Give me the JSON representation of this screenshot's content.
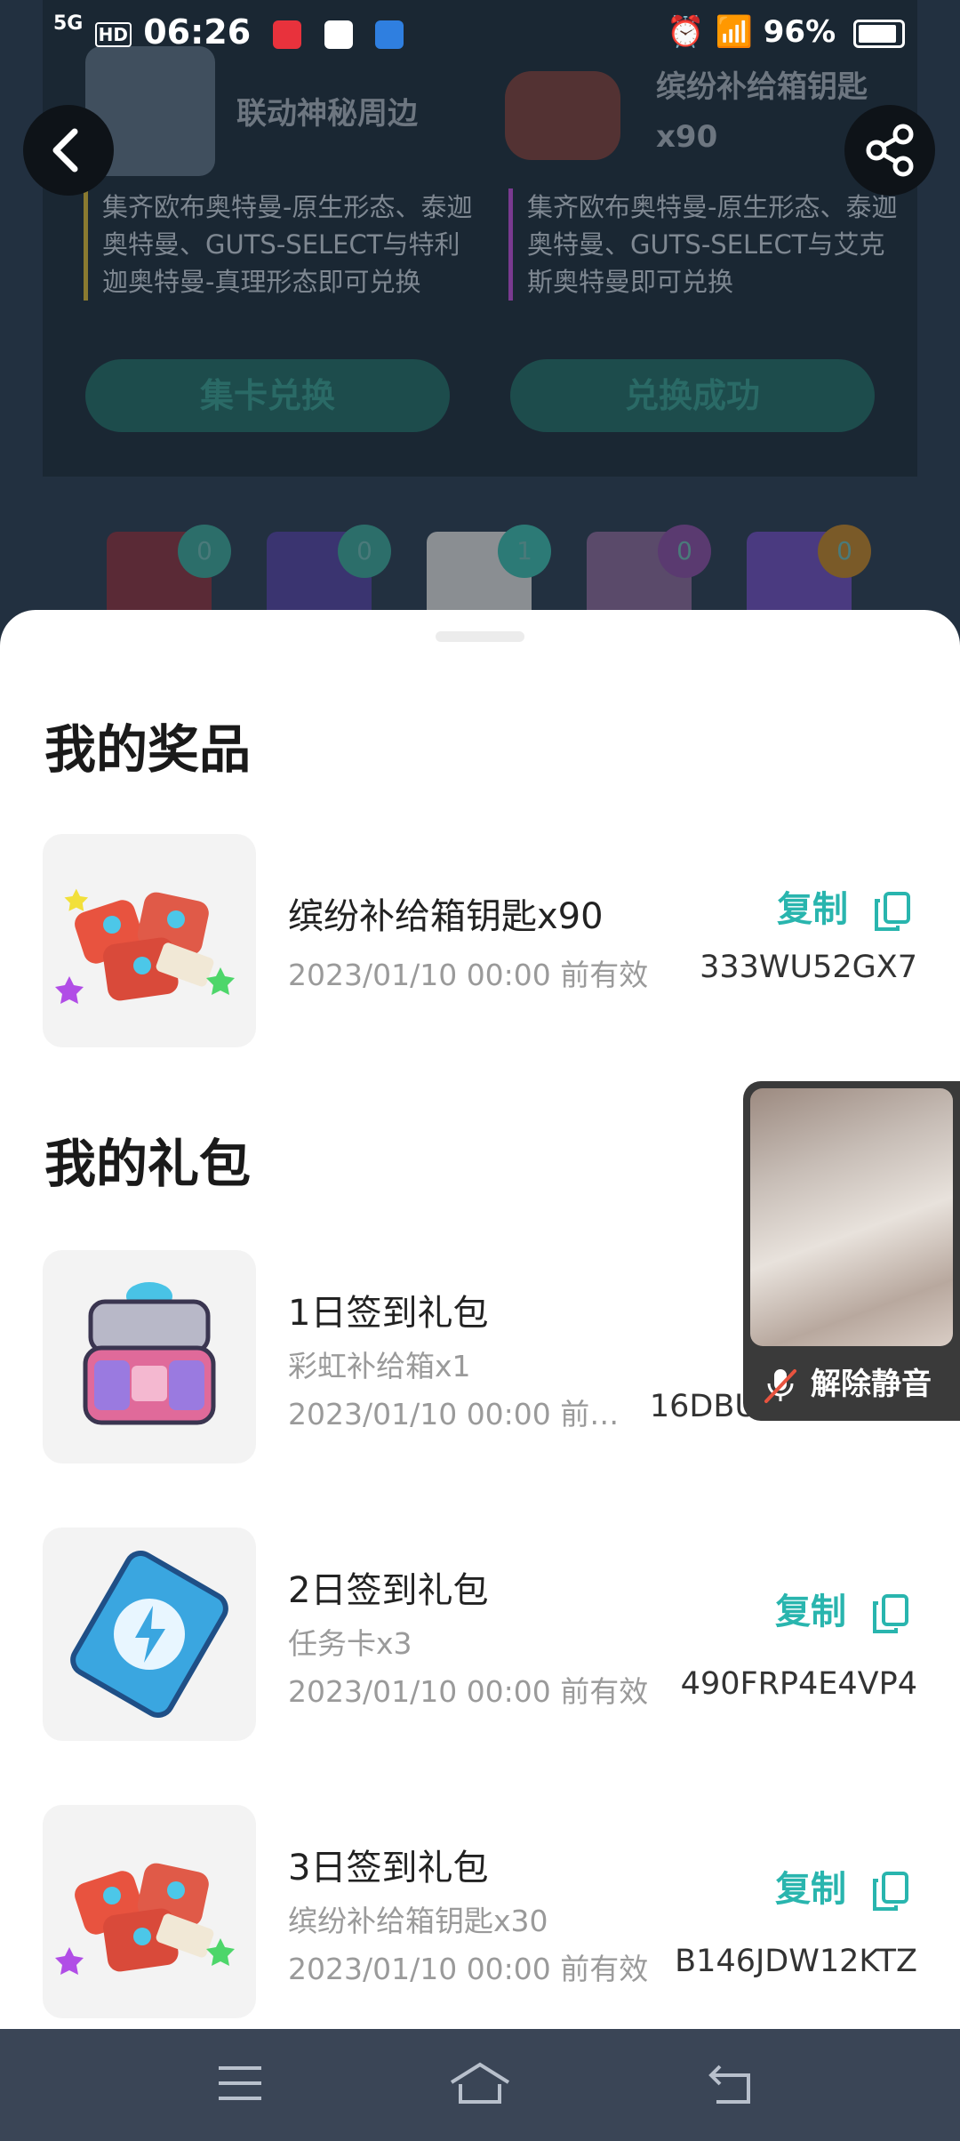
{
  "status_bar": {
    "network": "5G",
    "hd": "HD",
    "time": "06:26",
    "battery": "96%"
  },
  "background": {
    "cards": [
      {
        "title": "联动神秘周边",
        "desc": "集齐欧布奥特曼-原生形态、泰迦奥特曼、GUTS-SELECT与特利迦奥特曼-真理形态即可兑换",
        "button": "集卡兑换"
      },
      {
        "title": "缤纷补给箱钥匙x90",
        "desc": "集齐欧布奥特曼-原生形态、泰迦奥特曼、GUTS-SELECT与艾克斯奥特曼即可兑换",
        "button": "兑换成功"
      }
    ],
    "counts": [
      "0",
      "0",
      "1",
      "0",
      "0"
    ]
  },
  "prizes": {
    "title": "我的奖品",
    "items": [
      {
        "name": "缤纷补给箱钥匙x90",
        "date": "2023/01/10 00:00 前有效",
        "code": "333WU52GX7",
        "copy": "复制",
        "icon": "supply-keys"
      }
    ]
  },
  "gifts": {
    "title": "我的礼包",
    "items": [
      {
        "name": "1日签到礼包",
        "sub": "彩虹补给箱x1",
        "date": "2023/01/10 00:00 前…",
        "code": "16DBU",
        "icon": "rainbow-chest"
      },
      {
        "name": "2日签到礼包",
        "sub": "任务卡x3",
        "date": "2023/01/10 00:00 前有效",
        "code": "490FRP4E4VP4",
        "copy": "复制",
        "icon": "task-card"
      },
      {
        "name": "3日签到礼包",
        "sub": "缤纷补给箱钥匙x30",
        "date": "2023/01/10 00:00 前有效",
        "code": "B146JDW12KTZ",
        "copy": "复制",
        "icon": "supply-keys"
      }
    ]
  },
  "pip": {
    "unmute": "解除静音"
  },
  "colors": {
    "accent": "#29b5ae",
    "sheet_bg": "#ffffff",
    "nav_bg": "#3a4556"
  }
}
